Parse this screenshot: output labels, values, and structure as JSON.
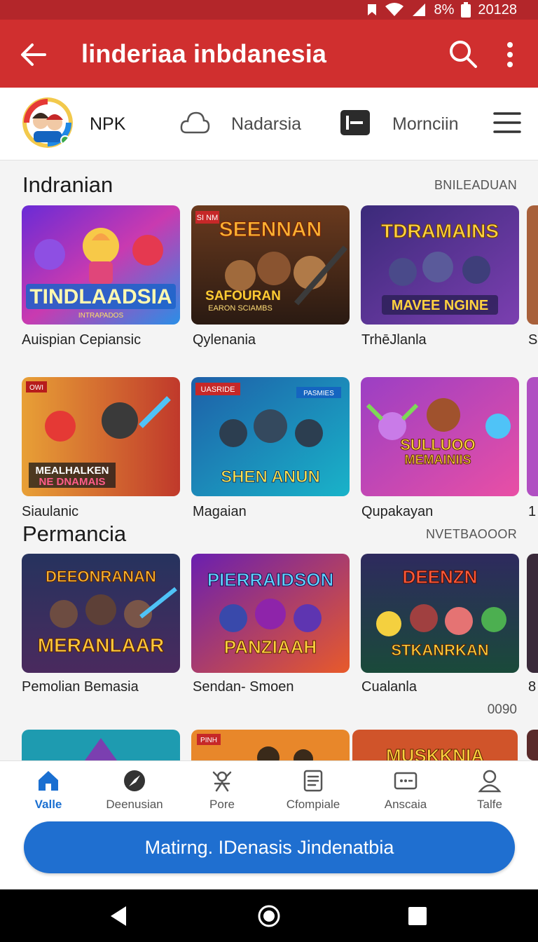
{
  "status_bar": {
    "battery": "8%",
    "time": "20128"
  },
  "app_bar": {
    "title": "linderiaa inbdanesia"
  },
  "nav_row": {
    "user_label": "NPK",
    "tab_1": "Nadarsia",
    "tab_2": "Mornciin"
  },
  "section_1": {
    "title": "Indranian",
    "link": "BNILEADUAN",
    "row_1": [
      {
        "caption": "Auispian Cepiansic",
        "art_title": "TINDLAADSIA",
        "art_sub": "INTRAPADOS"
      },
      {
        "caption": "Qylenania",
        "art_title": "SEENNAN",
        "art_sub": "SAFOURAN",
        "art_sub2": "EARON SCIAMBS",
        "tag": "SI NM"
      },
      {
        "caption": "TrhēJlanla",
        "art_title": "TDRAMAINS",
        "art_sub": "MAVEE NGINE"
      }
    ],
    "row_1_partial_caption": "S",
    "row_2": [
      {
        "caption": "Siaulanic",
        "art_title": "MEALHALKEN",
        "art_sub": "NE DNAMAIS",
        "tag": "OWI"
      },
      {
        "caption": "Magaian",
        "art_title": "SHEN ANUN",
        "tag": "UASRIDE",
        "tag2": "PASMIES"
      },
      {
        "caption": "Qupakayan",
        "art_title": "SULLUOO",
        "art_sub": "MEMAINIIS"
      }
    ],
    "row_2_partial_caption": "1"
  },
  "section_2": {
    "title": "Permancia",
    "link": "NVETBAOOOR",
    "row_1": [
      {
        "caption": "Pemolian Bemasia",
        "art_title": "DEEONRANAN",
        "art_sub": "MERANLAAR"
      },
      {
        "caption": "Sendan- Smoen",
        "art_title": "PIERRAIDSON",
        "art_sub": "PANZIAAH"
      },
      {
        "caption": "Cualanla",
        "art_title": "DEENZN",
        "art_sub": "STKANRKAN"
      }
    ],
    "row_1_partial_caption": "8",
    "counter": "0090",
    "row_2_art": [
      "",
      "",
      "MUSKKNIA"
    ],
    "row_2_tag": "PINH"
  },
  "bottom_nav": [
    {
      "label": "Valle",
      "icon": "home-icon",
      "active": true
    },
    {
      "label": "Deenusian",
      "icon": "compass-icon",
      "active": false
    },
    {
      "label": "Pore",
      "icon": "game-character-icon",
      "active": false
    },
    {
      "label": "Cfompiale",
      "icon": "document-icon",
      "active": false
    },
    {
      "label": "Anscaia",
      "icon": "ticket-icon",
      "active": false
    },
    {
      "label": "Talfe",
      "icon": "profile-icon",
      "active": false
    }
  ],
  "cta_label": "Matirng. IDenasis Jindenatbia",
  "colors": {
    "app_bar": "#d02f2f",
    "status_bar": "#b3262a",
    "accent": "#1f6fd0"
  }
}
